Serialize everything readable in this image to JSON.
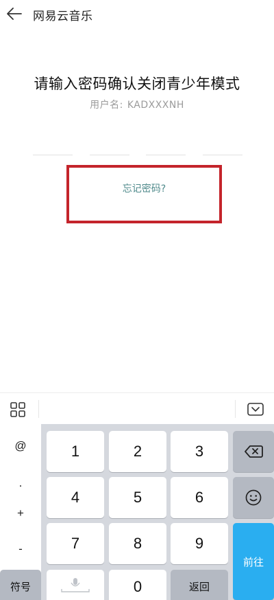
{
  "header": {
    "back_icon": "arrow-left-icon",
    "title": "网易云音乐"
  },
  "prompt": {
    "title": "请输入密码确认关闭青少年模式",
    "username_label": "用户名:",
    "username_value": "KADXXXNH"
  },
  "pin": {
    "slots": 4
  },
  "forgot_password": "忘记密码?",
  "colors": {
    "highlight_frame": "#c4242b",
    "link": "#4f8a8b",
    "confirm_key": "#2aaef0",
    "keyboard_bg": "#d5d8de"
  },
  "keyboard": {
    "toolbar": {
      "grid_icon": "grid-icon",
      "hide_icon": "keyboard-hide-icon"
    },
    "symbols": [
      "@",
      ".",
      "+",
      "-"
    ],
    "digits": {
      "k1": "1",
      "k2": "2",
      "k3": "3",
      "k4": "4",
      "k5": "5",
      "k6": "6",
      "k7": "7",
      "k8": "8",
      "k9": "9",
      "k0": "0"
    },
    "symbols_key": "符号",
    "return_key": "返回",
    "confirm_key": "前往",
    "backspace_icon": "backspace-icon",
    "emoji_icon": "emoji-icon",
    "mic_icon": "microphone-icon"
  }
}
